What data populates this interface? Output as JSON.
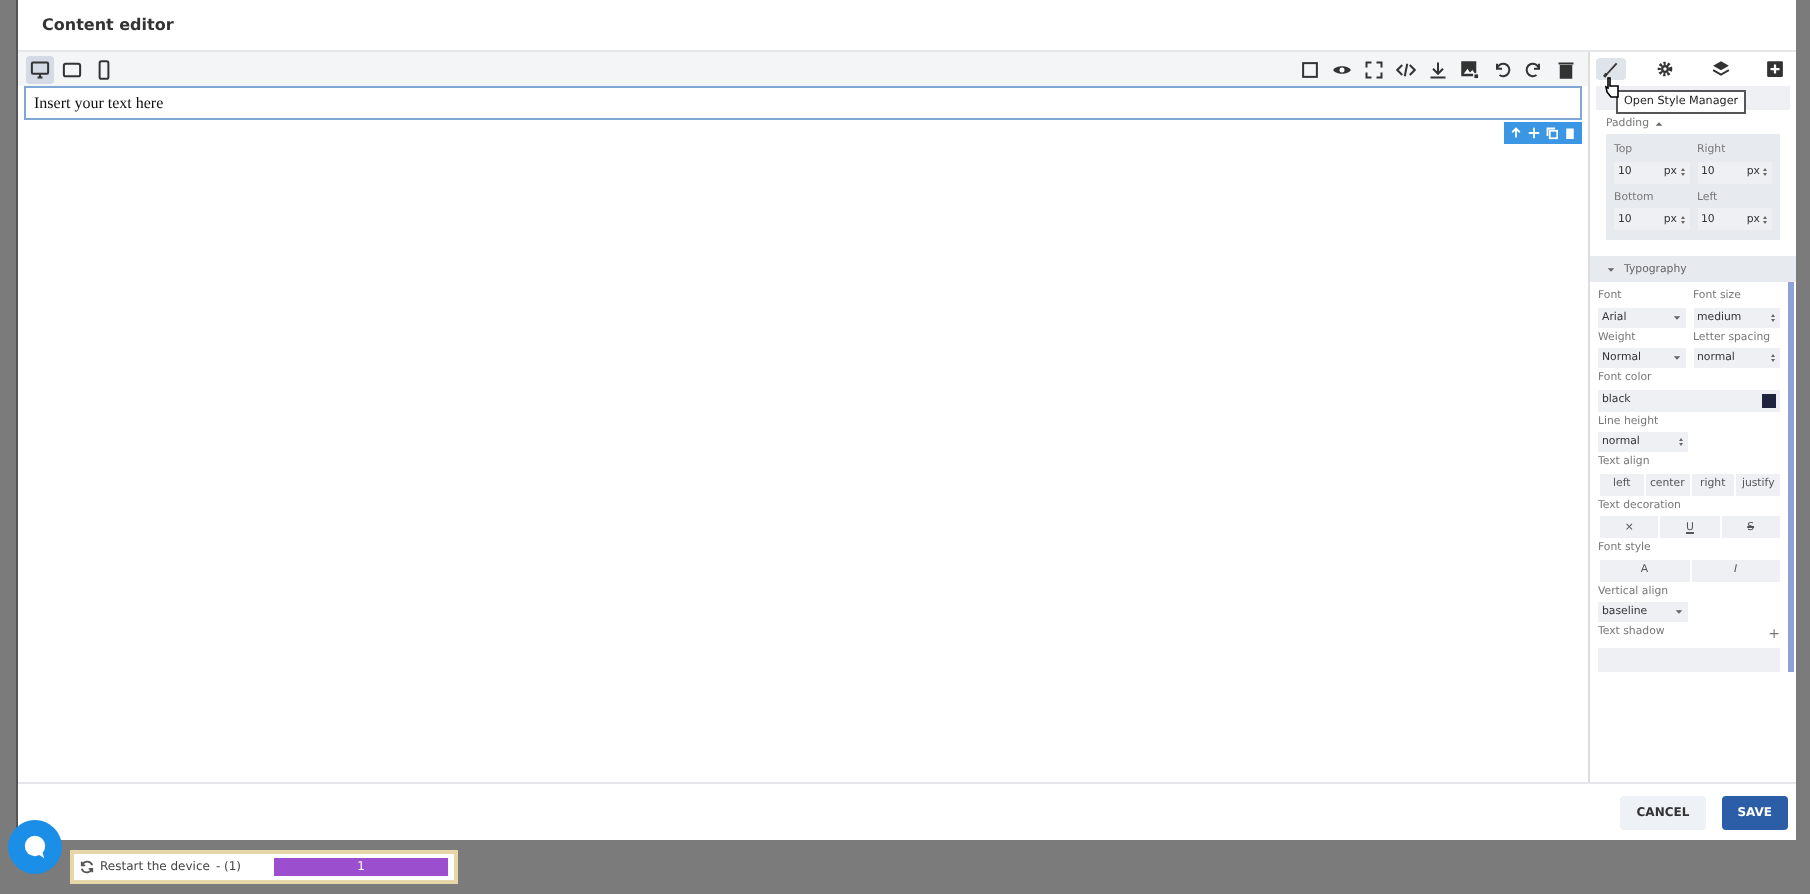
{
  "window": {
    "title": "Content editor"
  },
  "devices": [
    {
      "kind": "desktop",
      "selected": true
    },
    {
      "kind": "tablet",
      "selected": false
    },
    {
      "kind": "mobile",
      "selected": false
    }
  ],
  "canvas": {
    "text": "Insert your text here",
    "selected": true
  },
  "panel_tabs": [
    {
      "kind": "style",
      "selected": true
    },
    {
      "kind": "settings",
      "selected": false
    },
    {
      "kind": "layers",
      "selected": false
    },
    {
      "kind": "blocks",
      "selected": false
    }
  ],
  "tooltip": "Open Style Manager",
  "padding": {
    "label": "Padding",
    "fields": [
      {
        "label": "Top",
        "value": "10",
        "unit": "px"
      },
      {
        "label": "Right",
        "value": "10",
        "unit": "px"
      },
      {
        "label": "Bottom",
        "value": "10",
        "unit": "px"
      },
      {
        "label": "Left",
        "value": "10",
        "unit": "px"
      }
    ]
  },
  "typography": {
    "title": "Typography",
    "expanded": true,
    "rows": [
      {
        "kind": "pair",
        "items": [
          {
            "kind": "select",
            "label": "Font",
            "value": "Arial"
          },
          {
            "kind": "number",
            "label": "Font size",
            "value": "medium"
          }
        ]
      },
      {
        "kind": "pair",
        "items": [
          {
            "kind": "select",
            "label": "Weight",
            "value": "Normal"
          },
          {
            "kind": "number",
            "label": "Letter spacing",
            "value": "normal"
          }
        ]
      },
      {
        "kind": "color",
        "label": "Font color",
        "value": "black",
        "color": "#1f2340"
      },
      {
        "kind": "number",
        "label": "Line height",
        "value": "normal"
      },
      {
        "kind": "buttons",
        "label": "Text align",
        "options": [
          "left",
          "center",
          "right",
          "justify"
        ]
      },
      {
        "kind": "buttons",
        "label": "Text decoration",
        "options": [
          "×",
          "U",
          "S"
        ]
      },
      {
        "kind": "buttons",
        "label": "Font style",
        "options": [
          "A",
          "I"
        ]
      },
      {
        "kind": "select",
        "label": "Vertical align",
        "value": "baseline"
      },
      {
        "kind": "stack",
        "label": "Text shadow",
        "add": "+"
      }
    ]
  },
  "footer_buttons": [
    {
      "kind": "secondary",
      "label": "CANCEL"
    },
    {
      "kind": "primary",
      "label": "SAVE"
    }
  ],
  "toast": {
    "label": "Restart the device",
    "count": "- (1)",
    "progress": {
      "level": 1,
      "text": "1"
    }
  }
}
